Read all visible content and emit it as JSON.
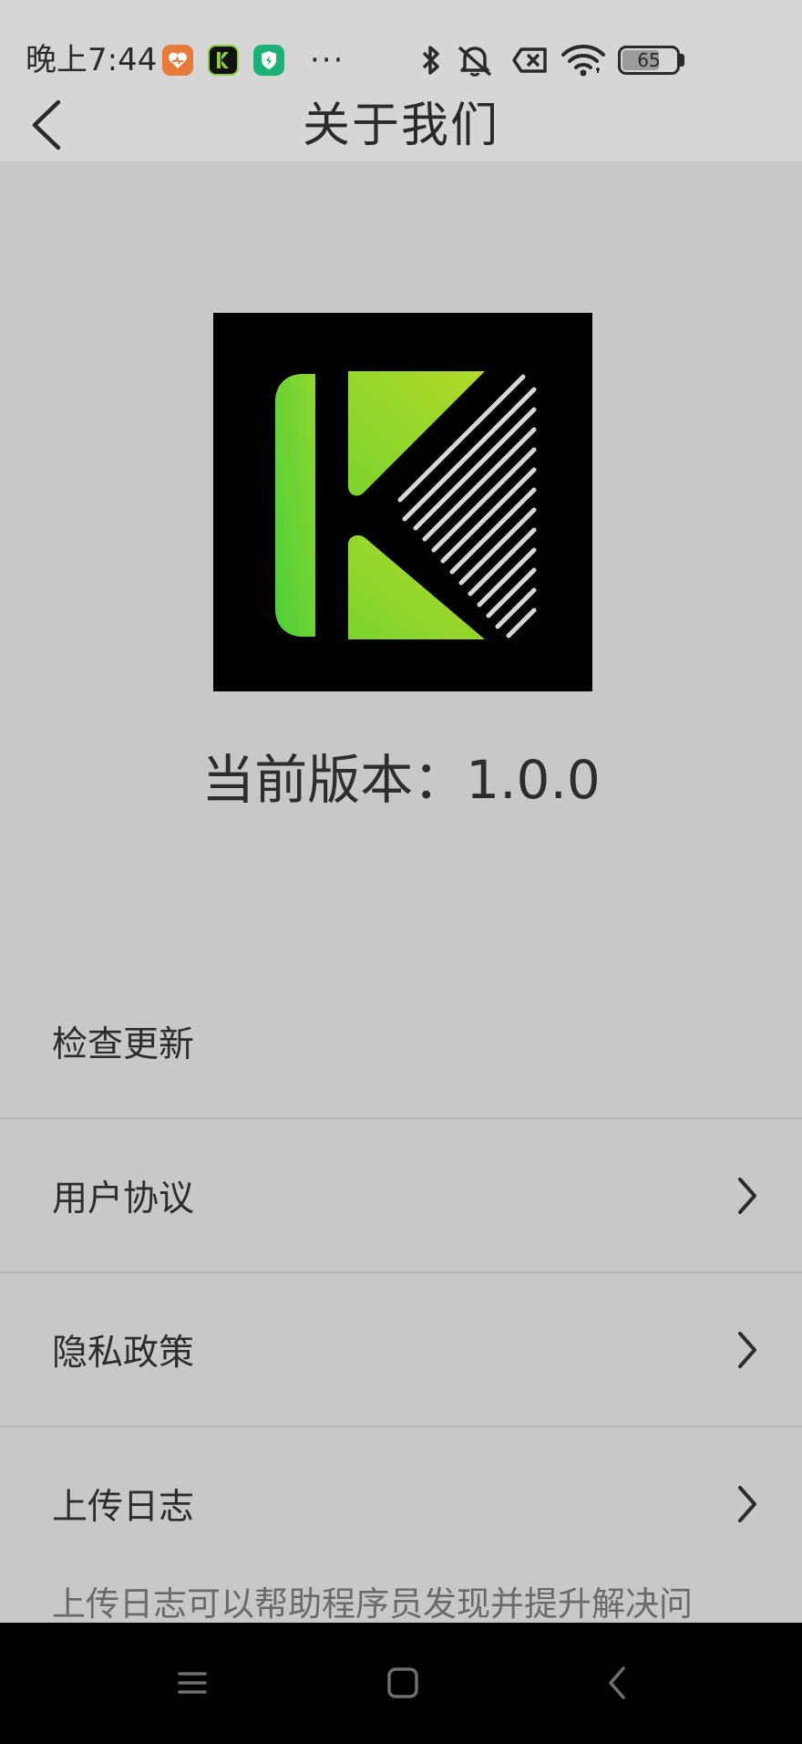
{
  "status_bar": {
    "time": "晚上7:44",
    "overflow_indicator": "···",
    "battery_level": "65",
    "notification_icons": [
      "health-app-icon",
      "kfit-app-icon",
      "shield-app-icon"
    ],
    "system_icons": [
      "bluetooth-icon",
      "mute-icon",
      "sim-off-icon",
      "wifi-icon",
      "battery-icon"
    ]
  },
  "header": {
    "title": "关于我们",
    "back_icon": "chevron-left-icon"
  },
  "logo": {
    "icon": "app-logo-k",
    "colors": {
      "background": "#000000",
      "green_dark": "#4ccf3a",
      "green_light": "#a8d825",
      "stripes": "#d8d8d8"
    }
  },
  "version": {
    "text": "当前版本：1.0.0"
  },
  "menu": {
    "items": [
      {
        "label": "检查更新",
        "has_chevron": false
      },
      {
        "label": "用户协议",
        "has_chevron": true
      },
      {
        "label": "隐私政策",
        "has_chevron": true
      },
      {
        "label": "上传日志",
        "has_chevron": true
      }
    ],
    "upload_hint": "上传日志可以帮助程序员发现并提升解决问"
  },
  "nav_bar": {
    "buttons": [
      "menu-icon",
      "home-icon",
      "back-icon"
    ]
  },
  "colors": {
    "page_background": "#c8c8c8",
    "header_background": "#d6d6d6",
    "nav_background": "#000000"
  }
}
